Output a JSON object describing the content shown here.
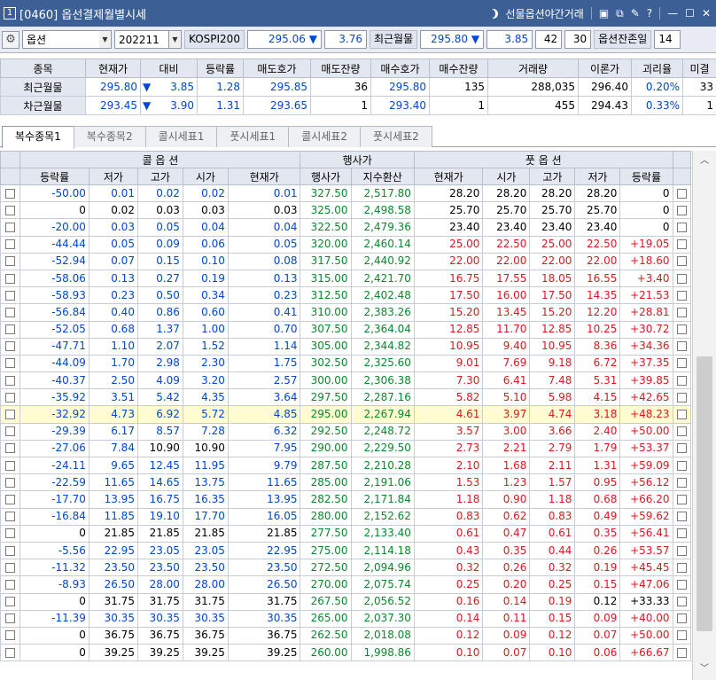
{
  "titlebar": {
    "badge": "1",
    "title": "[0460] 옵선결제월별시세",
    "right_label": "선물옵션야간거래"
  },
  "toolbar": {
    "product": "옵션",
    "month": "202211",
    "index_name": "KOSPI200",
    "index_value": "295.06",
    "index_arrow": "▼",
    "index_change": "3.76",
    "near_label": "최근월물",
    "near_value": "295.80",
    "near_arrow": "▼",
    "near_change": "3.85",
    "v1": "42",
    "v2": "30",
    "remain_label": "옵션잔존일",
    "remain_value": "14"
  },
  "summary": {
    "headers": [
      "종목",
      "현재가",
      "대비",
      "등락률",
      "매도호가",
      "매도잔량",
      "매수호가",
      "매수잔량",
      "거래량",
      "이론가",
      "괴리율",
      "미결"
    ],
    "rows": [
      {
        "name": "최근월물",
        "price": "295.80",
        "arrow": "▼",
        "change": "3.85",
        "rate": "1.28",
        "ask": "295.85",
        "ask_qty": "36",
        "bid": "295.80",
        "bid_qty": "135",
        "volume": "288,035",
        "theory": "296.40",
        "gap": "0.20%",
        "oi": "33"
      },
      {
        "name": "차근월물",
        "price": "293.45",
        "arrow": "▼",
        "change": "3.90",
        "rate": "1.31",
        "ask": "293.65",
        "ask_qty": "1",
        "bid": "293.40",
        "bid_qty": "1",
        "volume": "455",
        "theory": "294.43",
        "gap": "0.33%",
        "oi": "1"
      }
    ]
  },
  "tabs": [
    "복수종목1",
    "복수종목2",
    "콜시세표1",
    "풋시세표1",
    "콜시세표2",
    "풋시세표2"
  ],
  "grid": {
    "group_call": "콜 옵 션",
    "group_strike": "행사가",
    "group_put": "풋 옵 션",
    "headers": [
      "등락률",
      "저가",
      "고가",
      "시가",
      "현재가",
      "행사가",
      "지수환산",
      "현재가",
      "시가",
      "고가",
      "저가",
      "등락률"
    ],
    "rows": [
      [
        "-50.00",
        "0.01",
        "0.02",
        "0.02",
        "0.01",
        "327.50",
        "2,517.80",
        "28.20",
        "28.20",
        "28.20",
        "28.20",
        "0"
      ],
      [
        "0",
        "0.02",
        "0.03",
        "0.03",
        "0.03",
        "325.00",
        "2,498.58",
        "25.70",
        "25.70",
        "25.70",
        "25.70",
        "0"
      ],
      [
        "-20.00",
        "0.03",
        "0.05",
        "0.04",
        "0.04",
        "322.50",
        "2,479.36",
        "23.40",
        "23.40",
        "23.40",
        "23.40",
        "0"
      ],
      [
        "-44.44",
        "0.05",
        "0.09",
        "0.06",
        "0.05",
        "320.00",
        "2,460.14",
        "25.00",
        "22.50",
        "25.00",
        "22.50",
        "+19.05"
      ],
      [
        "-52.94",
        "0.07",
        "0.15",
        "0.10",
        "0.08",
        "317.50",
        "2,440.92",
        "22.00",
        "22.00",
        "22.00",
        "22.00",
        "+18.60"
      ],
      [
        "-58.06",
        "0.13",
        "0.27",
        "0.19",
        "0.13",
        "315.00",
        "2,421.70",
        "16.75",
        "17.55",
        "18.05",
        "16.55",
        "+3.40"
      ],
      [
        "-58.93",
        "0.23",
        "0.50",
        "0.34",
        "0.23",
        "312.50",
        "2,402.48",
        "17.50",
        "16.00",
        "17.50",
        "14.35",
        "+21.53"
      ],
      [
        "-56.84",
        "0.40",
        "0.86",
        "0.60",
        "0.41",
        "310.00",
        "2,383.26",
        "15.20",
        "13.45",
        "15.20",
        "12.20",
        "+28.81"
      ],
      [
        "-52.05",
        "0.68",
        "1.37",
        "1.00",
        "0.70",
        "307.50",
        "2,364.04",
        "12.85",
        "11.70",
        "12.85",
        "10.25",
        "+30.72"
      ],
      [
        "-47.71",
        "1.10",
        "2.07",
        "1.52",
        "1.14",
        "305.00",
        "2,344.82",
        "10.95",
        "9.40",
        "10.95",
        "8.36",
        "+34.36"
      ],
      [
        "-44.09",
        "1.70",
        "2.98",
        "2.30",
        "1.75",
        "302.50",
        "2,325.60",
        "9.01",
        "7.69",
        "9.18",
        "6.72",
        "+37.35"
      ],
      [
        "-40.37",
        "2.50",
        "4.09",
        "3.20",
        "2.57",
        "300.00",
        "2,306.38",
        "7.30",
        "6.41",
        "7.48",
        "5.31",
        "+39.85"
      ],
      [
        "-35.92",
        "3.51",
        "5.42",
        "4.35",
        "3.64",
        "297.50",
        "2,287.16",
        "5.82",
        "5.10",
        "5.98",
        "4.15",
        "+42.65"
      ],
      [
        "-32.92",
        "4.73",
        "6.92",
        "5.72",
        "4.85",
        "295.00",
        "2,267.94",
        "4.61",
        "3.97",
        "4.74",
        "3.18",
        "+48.23"
      ],
      [
        "-29.39",
        "6.17",
        "8.57",
        "7.28",
        "6.32",
        "292.50",
        "2,248.72",
        "3.57",
        "3.00",
        "3.66",
        "2.40",
        "+50.00"
      ],
      [
        "-27.06",
        "7.84",
        "10.90",
        "10.90",
        "7.95",
        "290.00",
        "2,229.50",
        "2.73",
        "2.21",
        "2.79",
        "1.79",
        "+53.37"
      ],
      [
        "-24.11",
        "9.65",
        "12.45",
        "11.95",
        "9.79",
        "287.50",
        "2,210.28",
        "2.10",
        "1.68",
        "2.11",
        "1.31",
        "+59.09"
      ],
      [
        "-22.59",
        "11.65",
        "14.65",
        "13.75",
        "11.65",
        "285.00",
        "2,191.06",
        "1.53",
        "1.23",
        "1.57",
        "0.95",
        "+56.12"
      ],
      [
        "-17.70",
        "13.95",
        "16.75",
        "16.35",
        "13.95",
        "282.50",
        "2,171.84",
        "1.18",
        "0.90",
        "1.18",
        "0.68",
        "+66.20"
      ],
      [
        "-16.84",
        "11.85",
        "19.10",
        "17.70",
        "16.05",
        "280.00",
        "2,152.62",
        "0.83",
        "0.62",
        "0.83",
        "0.49",
        "+59.62"
      ],
      [
        "0",
        "21.85",
        "21.85",
        "21.85",
        "21.85",
        "277.50",
        "2,133.40",
        "0.61",
        "0.47",
        "0.61",
        "0.35",
        "+56.41"
      ],
      [
        "-5.56",
        "22.95",
        "23.05",
        "23.05",
        "22.95",
        "275.00",
        "2,114.18",
        "0.43",
        "0.35",
        "0.44",
        "0.26",
        "+53.57"
      ],
      [
        "-11.32",
        "23.50",
        "23.50",
        "23.50",
        "23.50",
        "272.50",
        "2,094.96",
        "0.32",
        "0.26",
        "0.32",
        "0.19",
        "+45.45"
      ],
      [
        "-8.93",
        "26.50",
        "28.00",
        "28.00",
        "26.50",
        "270.00",
        "2,075.74",
        "0.25",
        "0.20",
        "0.25",
        "0.15",
        "+47.06"
      ],
      [
        "0",
        "31.75",
        "31.75",
        "31.75",
        "31.75",
        "267.50",
        "2,056.52",
        "0.16",
        "0.14",
        "0.19",
        "0.12",
        "+33.33"
      ],
      [
        "-11.39",
        "30.35",
        "30.35",
        "30.35",
        "30.35",
        "265.00",
        "2,037.30",
        "0.14",
        "0.11",
        "0.15",
        "0.09",
        "+40.00"
      ],
      [
        "0",
        "36.75",
        "36.75",
        "36.75",
        "36.75",
        "262.50",
        "2,018.08",
        "0.12",
        "0.09",
        "0.12",
        "0.07",
        "+50.00"
      ],
      [
        "0",
        "39.25",
        "39.25",
        "39.25",
        "39.25",
        "260.00",
        "1,998.86",
        "0.10",
        "0.07",
        "0.10",
        "0.06",
        "+66.67"
      ]
    ],
    "highlight_row": 13
  },
  "colors": {
    "title_bg": "#3c5f95",
    "up": "#e0181e",
    "down": "#0047d6",
    "strike": "#0a8a2a",
    "highlight": "#fffcd0"
  }
}
